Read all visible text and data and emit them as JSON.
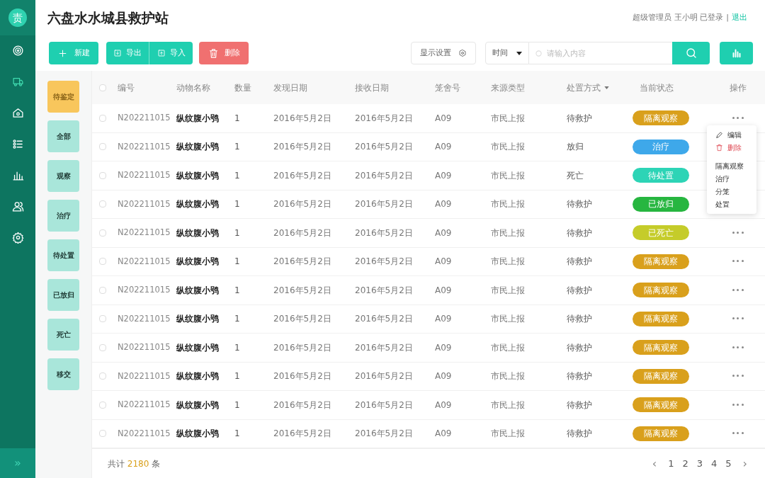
{
  "sidebar": {
    "logo": "责",
    "items": [
      {
        "selected": false
      },
      {
        "selected": true
      },
      {
        "selected": false
      },
      {
        "selected": false
      },
      {
        "selected": false
      },
      {
        "selected": false
      },
      {
        "selected": false
      }
    ],
    "expand": "»"
  },
  "header": {
    "title": "六盘水水城县救护站",
    "user": "超级管理员 王小明 已登录",
    "separator": "|",
    "logout": "退出"
  },
  "toolbar": {
    "new": "新建",
    "export": "导出",
    "import": "导入",
    "delete": "删除",
    "display_settings": "显示设置",
    "filter_select": "时间",
    "search": {
      "placeholder": "请输入内容"
    }
  },
  "filters": [
    {
      "label": "待鉴定",
      "selected": true
    },
    {
      "label": "全部",
      "selected": false
    },
    {
      "label": "观察",
      "selected": false
    },
    {
      "label": "治疗",
      "selected": false
    },
    {
      "label": "待处置",
      "selected": false
    },
    {
      "label": "已放归",
      "selected": false
    },
    {
      "label": "死亡",
      "selected": false
    },
    {
      "label": "移交",
      "selected": false
    }
  ],
  "table": {
    "select_all_checked": false,
    "columns": [
      {
        "label": "编号",
        "sortable": false
      },
      {
        "label": "动物名称",
        "sortable": false
      },
      {
        "label": "数量",
        "sortable": false
      },
      {
        "label": "发现日期",
        "sortable": false
      },
      {
        "label": "接收日期",
        "sortable": false
      },
      {
        "label": "笼舍号",
        "sortable": false
      },
      {
        "label": "来源类型",
        "sortable": false
      },
      {
        "label": "处置方式",
        "sortable": true
      },
      {
        "label": "当前状态",
        "sortable": false
      },
      {
        "label": "操作",
        "sortable": false
      }
    ],
    "rows": [
      {
        "checked": false,
        "id": "N202211015",
        "name": "纵纹腹小鸮",
        "count": "1",
        "found": "2016年5月2日",
        "received": "2016年5月2日",
        "cage": "A09",
        "source": "市民上报",
        "disposal": "待救护",
        "status": "隔离观察",
        "color": "#d9a01c"
      },
      {
        "checked": false,
        "id": "N202211015",
        "name": "纵纹腹小鸮",
        "count": "1",
        "found": "2016年5月2日",
        "received": "2016年5月2日",
        "cage": "A09",
        "source": "市民上报",
        "disposal": "放归",
        "status": "治疗",
        "color": "#3ea8ea"
      },
      {
        "checked": false,
        "id": "N202211015",
        "name": "纵纹腹小鸮",
        "count": "1",
        "found": "2016年5月2日",
        "received": "2016年5月2日",
        "cage": "A09",
        "source": "市民上报",
        "disposal": "死亡",
        "status": "待处置",
        "color": "#2dd4b6"
      },
      {
        "checked": false,
        "id": "N202211015",
        "name": "纵纹腹小鸮",
        "count": "1",
        "found": "2016年5月2日",
        "received": "2016年5月2日",
        "cage": "A09",
        "source": "市民上报",
        "disposal": "待救护",
        "status": "已放归",
        "color": "#27b640"
      },
      {
        "checked": false,
        "id": "N202211015",
        "name": "纵纹腹小鸮",
        "count": "1",
        "found": "2016年5月2日",
        "received": "2016年5月2日",
        "cage": "A09",
        "source": "市民上报",
        "disposal": "待救护",
        "status": "已死亡",
        "color": "#c5cc2a"
      },
      {
        "checked": false,
        "id": "N202211015",
        "name": "纵纹腹小鸮",
        "count": "1",
        "found": "2016年5月2日",
        "received": "2016年5月2日",
        "cage": "A09",
        "source": "市民上报",
        "disposal": "待救护",
        "status": "隔离观察",
        "color": "#d9a01c"
      },
      {
        "checked": false,
        "id": "N202211015",
        "name": "纵纹腹小鸮",
        "count": "1",
        "found": "2016年5月2日",
        "received": "2016年5月2日",
        "cage": "A09",
        "source": "市民上报",
        "disposal": "待救护",
        "status": "隔离观察",
        "color": "#d9a01c"
      },
      {
        "checked": false,
        "id": "N202211015",
        "name": "纵纹腹小鸮",
        "count": "1",
        "found": "2016年5月2日",
        "received": "2016年5月2日",
        "cage": "A09",
        "source": "市民上报",
        "disposal": "待救护",
        "status": "隔离观察",
        "color": "#d9a01c"
      },
      {
        "checked": false,
        "id": "N202211015",
        "name": "纵纹腹小鸮",
        "count": "1",
        "found": "2016年5月2日",
        "received": "2016年5月2日",
        "cage": "A09",
        "source": "市民上报",
        "disposal": "待救护",
        "status": "隔离观察",
        "color": "#d9a01c"
      },
      {
        "checked": false,
        "id": "N202211015",
        "name": "纵纹腹小鸮",
        "count": "1",
        "found": "2016年5月2日",
        "received": "2016年5月2日",
        "cage": "A09",
        "source": "市民上报",
        "disposal": "待救护",
        "status": "隔离观察",
        "color": "#d9a01c"
      },
      {
        "checked": false,
        "id": "N202211015",
        "name": "纵纹腹小鸮",
        "count": "1",
        "found": "2016年5月2日",
        "received": "2016年5月2日",
        "cage": "A09",
        "source": "市民上报",
        "disposal": "待救护",
        "status": "隔离观察",
        "color": "#d9a01c"
      },
      {
        "checked": false,
        "id": "N202211015",
        "name": "纵纹腹小鸮",
        "count": "1",
        "found": "2016年5月2日",
        "received": "2016年5月2日",
        "cage": "A09",
        "source": "市民上报",
        "disposal": "待救护",
        "status": "隔离观察",
        "color": "#d9a01c"
      }
    ]
  },
  "row_menu": [
    {
      "kind": "edit",
      "label": "编辑"
    },
    {
      "kind": "delete",
      "label": "删除"
    },
    {
      "kind": "plain",
      "label": "隔离观察"
    },
    {
      "kind": "plain",
      "label": "治疗"
    },
    {
      "kind": "plain",
      "label": "分笼"
    },
    {
      "kind": "plain",
      "label": "处置"
    }
  ],
  "footer": {
    "total_prefix": "共计",
    "total": "2180",
    "total_suffix": "条",
    "prev": "‹",
    "pages": [
      {
        "label": "1",
        "selected": false
      },
      {
        "label": "2",
        "selected": false
      },
      {
        "label": "3",
        "selected": false
      },
      {
        "label": "4",
        "selected": false
      },
      {
        "label": "5",
        "selected": false
      }
    ],
    "next": "›"
  }
}
